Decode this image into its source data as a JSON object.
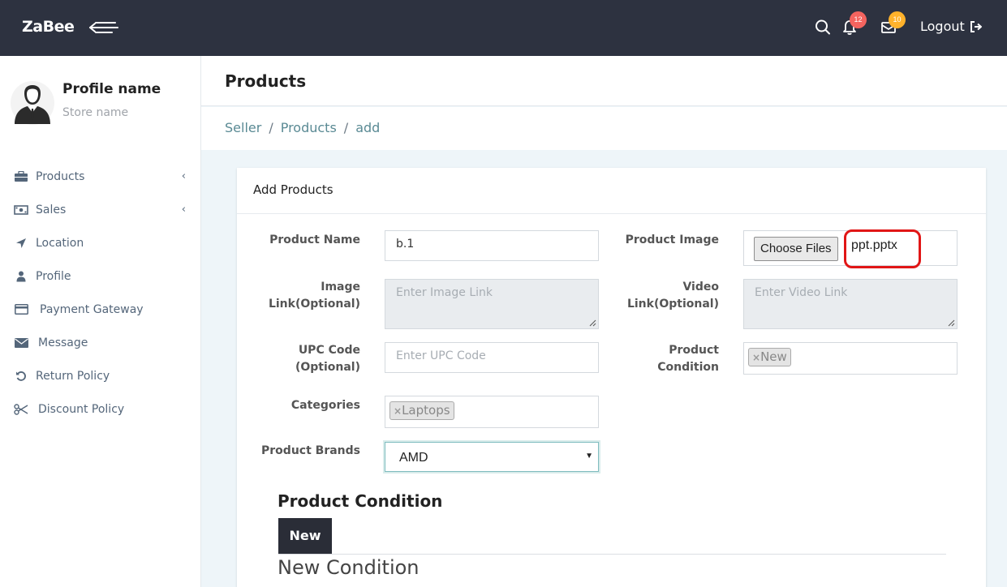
{
  "topbar": {
    "brand": "ZaBee",
    "notifications_count": "12",
    "messages_count": "10",
    "logout_label": "Logout"
  },
  "profile": {
    "name": "Profile name",
    "store": "Store name"
  },
  "sidebar": {
    "items": [
      {
        "label": "Products",
        "icon": "briefcase-icon",
        "has_chevron": true
      },
      {
        "label": "Sales",
        "icon": "money-icon",
        "has_chevron": true
      },
      {
        "label": "Location",
        "icon": "location-arrow-icon",
        "has_chevron": false
      },
      {
        "label": "Profile",
        "icon": "user-icon",
        "has_chevron": false
      },
      {
        "label": "Payment Gateway",
        "icon": "credit-card-icon",
        "has_chevron": false
      },
      {
        "label": "Message",
        "icon": "envelope-icon",
        "has_chevron": false
      },
      {
        "label": "Return Policy",
        "icon": "undo-icon",
        "has_chevron": false
      },
      {
        "label": "Discount Policy",
        "icon": "scissors-icon",
        "has_chevron": false
      }
    ]
  },
  "page": {
    "title": "Products",
    "breadcrumb": [
      "Seller",
      "Products",
      "add"
    ]
  },
  "form": {
    "card_title": "Add Products",
    "product_name": {
      "label": "Product Name",
      "value": "b.1"
    },
    "product_image": {
      "label": "Product Image",
      "button": "Choose Files",
      "file": "ppt.pptx"
    },
    "image_link": {
      "label_line1": "Image",
      "label_line2": "Link(Optional)",
      "placeholder": "Enter Image Link"
    },
    "video_link": {
      "label_line1": "Video",
      "label_line2": "Link(Optional)",
      "placeholder": "Enter Video Link"
    },
    "upc_code": {
      "label_line1": "UPC Code",
      "label_line2": "(Optional)",
      "placeholder": "Enter UPC Code"
    },
    "product_condition": {
      "label_line1": "Product",
      "label_line2": "Condition",
      "tag": "New",
      "remove": "×"
    },
    "categories": {
      "label": "Categories",
      "tag": "Laptops",
      "remove": "×"
    },
    "brands": {
      "label": "Product Brands",
      "value": "AMD"
    }
  },
  "condition_section": {
    "title": "Product Condition",
    "tab": "New",
    "subtitle": "New Condition"
  },
  "colors": {
    "topbar": "#2d3240",
    "badge_red": "#f4645f",
    "badge_orange": "#ffb22b",
    "highlight": "#e11616"
  }
}
